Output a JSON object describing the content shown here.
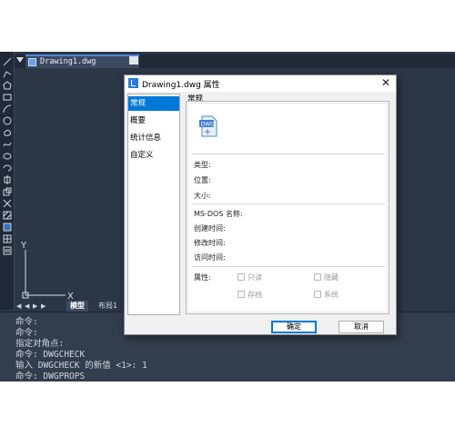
{
  "document_tab": {
    "label": "Drawing1.dwg",
    "close_glyph": "×"
  },
  "layout_tabs": [
    {
      "label": "模型",
      "active": true
    },
    {
      "label": "布局1",
      "active": false
    }
  ],
  "command_history": [
    "命令:",
    "命令:",
    "指定对角点:",
    "命令: DWGCHECK",
    "输入 DWGCHECK 的新值 <1>: 1",
    "命令: DWGPROPS"
  ],
  "ucs_icon": {
    "x_label": "X",
    "y_label": "Y"
  },
  "dialog": {
    "title": "Drawing1.dwg 属性",
    "close_glyph": "✕",
    "nav_items": [
      "常规",
      "概要",
      "统计信息",
      "自定义"
    ],
    "selected_nav": 0,
    "group_label": "常规",
    "file_icon_text": "DWG",
    "fields": {
      "type": "类型:",
      "location": "位置:",
      "size": "大小:",
      "msdos_name": "MS-DOS 名称:",
      "created": "创建时间:",
      "modified": "修改时间:",
      "accessed": "访问时间:",
      "attributes": "属性:"
    },
    "attributes": {
      "readonly": "只读",
      "hidden": "隐藏",
      "archive": "存档",
      "system": "系统"
    },
    "ok_label": "确定",
    "cancel_label": "取消"
  },
  "colors": {
    "canvas": "#2b3647",
    "toolbar": "#1f2937",
    "selection": "#0078d7",
    "accent": "#4f86d8"
  }
}
